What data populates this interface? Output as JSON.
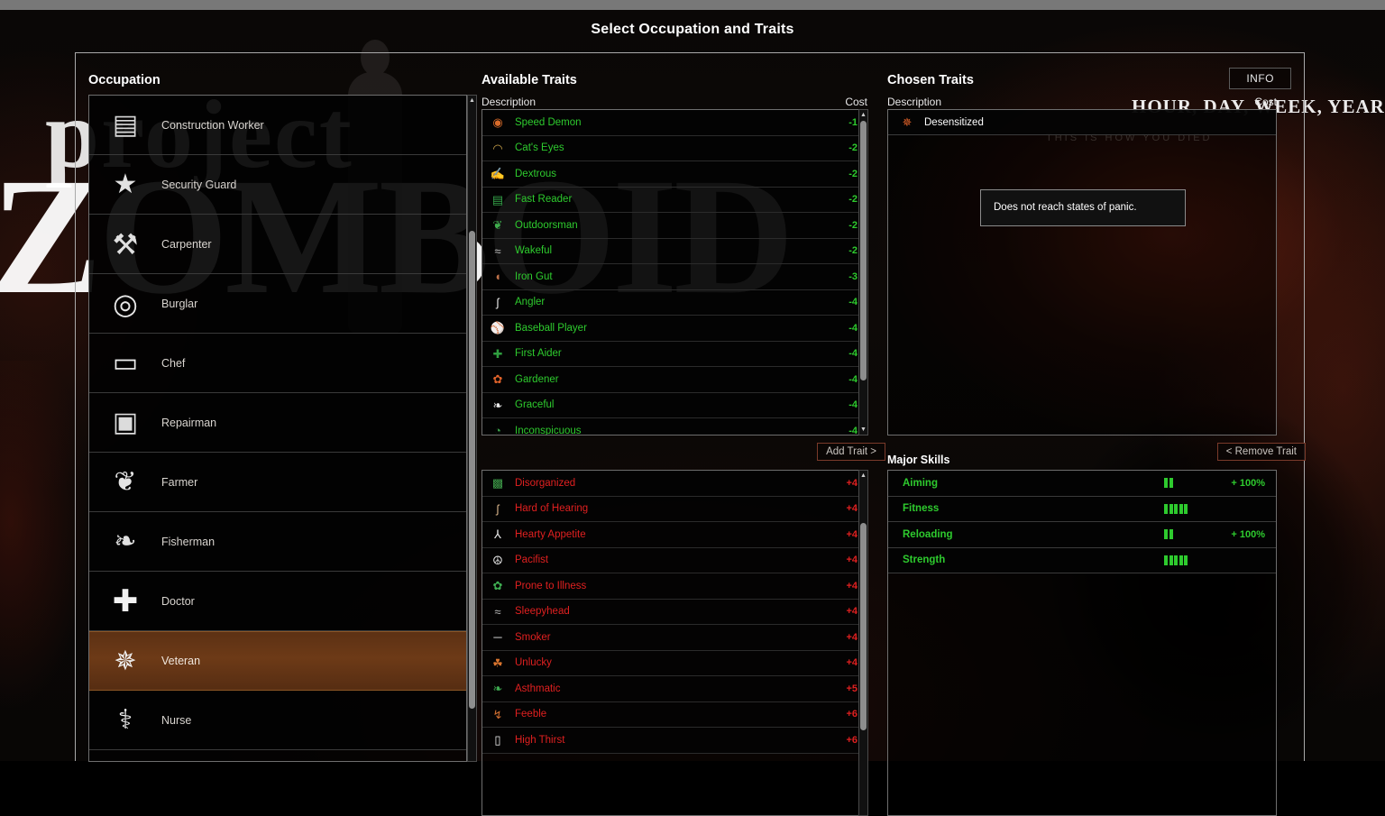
{
  "window": {
    "title": "Select Occupation and Traits"
  },
  "occupation": {
    "heading": "Occupation",
    "selected": "Veteran",
    "items": [
      {
        "label": "Construction Worker",
        "icon": "bricks-icon",
        "selected": false
      },
      {
        "label": "Security Guard",
        "icon": "badge-icon",
        "selected": false
      },
      {
        "label": "Carpenter",
        "icon": "hammer-icon",
        "selected": false
      },
      {
        "label": "Burglar",
        "icon": "fingerprint-icon",
        "selected": false
      },
      {
        "label": "Chef",
        "icon": "chef-hat-icon",
        "selected": false
      },
      {
        "label": "Repairman",
        "icon": "toolbox-icon",
        "selected": false
      },
      {
        "label": "Farmer",
        "icon": "corn-icon",
        "selected": false
      },
      {
        "label": "Fisherman",
        "icon": "fishing-lure-icon",
        "selected": false
      },
      {
        "label": "Doctor",
        "icon": "medical-cross-icon",
        "selected": false
      },
      {
        "label": "Veteran",
        "icon": "military-seal-icon",
        "selected": true
      },
      {
        "label": "Nurse",
        "icon": "nurse-caduceus-icon",
        "selected": false
      }
    ]
  },
  "available_traits": {
    "heading": "Available Traits",
    "columns": {
      "description": "Description",
      "cost": "Cost"
    },
    "add_button": "Add Trait >",
    "positive": [
      {
        "name": "Speed Demon",
        "cost": "-1",
        "icon": "steering-wheel-icon"
      },
      {
        "name": "Cat's Eyes",
        "cost": "-2",
        "icon": "cat-eyes-icon"
      },
      {
        "name": "Dextrous",
        "cost": "-2",
        "icon": "hand-icon"
      },
      {
        "name": "Fast Reader",
        "cost": "-2",
        "icon": "book-icon"
      },
      {
        "name": "Outdoorsman",
        "cost": "-2",
        "icon": "leaf-icon"
      },
      {
        "name": "Wakeful",
        "cost": "-2",
        "icon": "sleep-zzz-icon"
      },
      {
        "name": "Iron Gut",
        "cost": "-3",
        "icon": "stomach-icon"
      },
      {
        "name": "Angler",
        "cost": "-4",
        "icon": "fish-hook-icon"
      },
      {
        "name": "Baseball Player",
        "cost": "-4",
        "icon": "baseball-icon"
      },
      {
        "name": "First Aider",
        "cost": "-4",
        "icon": "first-aid-icon"
      },
      {
        "name": "Gardener",
        "cost": "-4",
        "icon": "flower-icon"
      },
      {
        "name": "Graceful",
        "cost": "-4",
        "icon": "swan-icon"
      },
      {
        "name": "Inconspicuous",
        "cost": "-4",
        "icon": "bush-icon"
      }
    ],
    "negative": [
      {
        "name": "Disorganized",
        "cost": "+4",
        "icon": "messy-box-icon"
      },
      {
        "name": "Hard of Hearing",
        "cost": "+4",
        "icon": "ear-icon"
      },
      {
        "name": "Hearty Appetite",
        "cost": "+4",
        "icon": "fork-icon"
      },
      {
        "name": "Pacifist",
        "cost": "+4",
        "icon": "peace-icon"
      },
      {
        "name": "Prone to Illness",
        "cost": "+4",
        "icon": "germ-icon"
      },
      {
        "name": "Sleepyhead",
        "cost": "+4",
        "icon": "sleep-zzz-icon"
      },
      {
        "name": "Smoker",
        "cost": "+4",
        "icon": "cigarette-icon"
      },
      {
        "name": "Unlucky",
        "cost": "+4",
        "icon": "clover-icon"
      },
      {
        "name": "Asthmatic",
        "cost": "+5",
        "icon": "lungs-icon"
      },
      {
        "name": "Feeble",
        "cost": "+6",
        "icon": "weak-arm-icon"
      },
      {
        "name": "High Thirst",
        "cost": "+6",
        "icon": "glass-icon"
      }
    ]
  },
  "chosen_traits": {
    "heading": "Chosen Traits",
    "columns": {
      "description": "Description",
      "cost": "Cost"
    },
    "info_button": "INFO",
    "remove_button": "< Remove Trait",
    "items": [
      {
        "name": "Desensitized",
        "cost": "",
        "icon": "person-orange-icon"
      }
    ],
    "tooltip": "Does not reach states of panic."
  },
  "major_skills": {
    "heading": "Major Skills",
    "items": [
      {
        "name": "Aiming",
        "bars": 2,
        "bonus": "+ 100%"
      },
      {
        "name": "Fitness",
        "bars": 5,
        "bonus": ""
      },
      {
        "name": "Reloading",
        "bars": 2,
        "bonus": "+ 100%"
      },
      {
        "name": "Strength",
        "bars": 5,
        "bonus": ""
      }
    ]
  },
  "background": {
    "logo_word_1": "project",
    "logo_word_2": "ZOMBOID",
    "tagline": "HOUR, DAY, WEEK, YEARS",
    "subtitle": "THIS IS HOW YOU DIED"
  }
}
